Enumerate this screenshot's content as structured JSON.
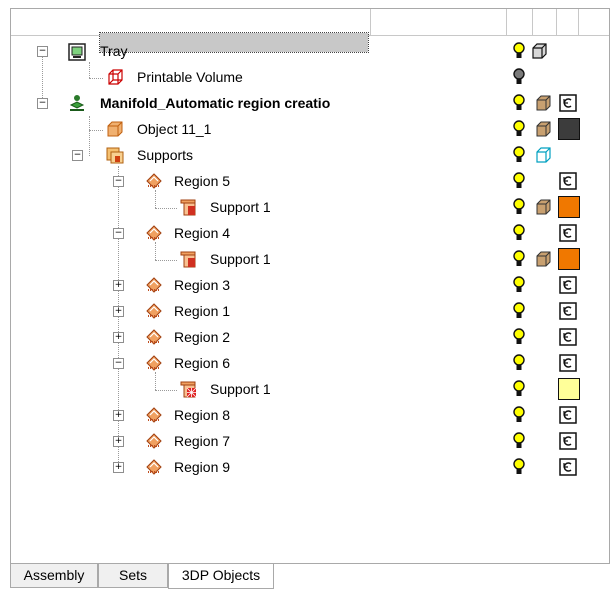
{
  "tree": {
    "nodes": [
      {
        "id": "tray",
        "label": "Tray",
        "bold": false,
        "selected": true,
        "icon": "tray-icon",
        "expanded": true
      },
      {
        "id": "printable-volume",
        "label": "Printable Volume",
        "bold": false,
        "icon": "printable-volume-icon"
      },
      {
        "id": "manifold",
        "label": "Manifold_Automatic region creatio",
        "bold": true,
        "icon": "manifold-icon",
        "expanded": true
      },
      {
        "id": "object-11-1",
        "label": "Object 11_1",
        "icon": "object-icon"
      },
      {
        "id": "supports",
        "label": "Supports",
        "icon": "supports-folder-icon",
        "expanded": true
      },
      {
        "id": "region-5",
        "label": "Region 5",
        "icon": "region-icon",
        "expanded": true
      },
      {
        "id": "region-5-support-1",
        "label": "Support 1",
        "icon": "support-icon"
      },
      {
        "id": "region-4",
        "label": "Region 4",
        "icon": "region-icon",
        "expanded": true
      },
      {
        "id": "region-4-support-1",
        "label": "Support 1",
        "icon": "support-icon"
      },
      {
        "id": "region-3",
        "label": "Region 3",
        "icon": "region-icon",
        "expanded": false
      },
      {
        "id": "region-1",
        "label": "Region 1",
        "icon": "region-icon",
        "expanded": false
      },
      {
        "id": "region-2",
        "label": "Region 2",
        "icon": "region-icon",
        "expanded": false
      },
      {
        "id": "region-6",
        "label": "Region 6",
        "icon": "region-icon",
        "expanded": true
      },
      {
        "id": "region-6-support-1",
        "label": "Support 1",
        "icon": "support-block-icon"
      },
      {
        "id": "region-8",
        "label": "Region 8",
        "icon": "region-icon",
        "expanded": false
      },
      {
        "id": "region-7",
        "label": "Region 7",
        "icon": "region-icon",
        "expanded": false
      },
      {
        "id": "region-9",
        "label": "Region 9",
        "icon": "region-icon",
        "expanded": false
      }
    ]
  },
  "columns": {
    "visibility_icon": "lightbulb-icon",
    "shading_icon": "shading-mode-icon",
    "color_icon": "color-swatch-icon"
  },
  "colors": {
    "object_swatch": "#3c3c3c",
    "support_swatch": "#f07800",
    "support_block_swatch": "#ffff99",
    "bulb_on": "#ffff00",
    "bulb_off": "#7a7a7a",
    "selection": "#c8c8c8"
  },
  "tabs": {
    "items": [
      {
        "label": "Assembly",
        "active": false
      },
      {
        "label": "Sets",
        "active": false
      },
      {
        "label": "3DP Objects",
        "active": true
      }
    ]
  }
}
